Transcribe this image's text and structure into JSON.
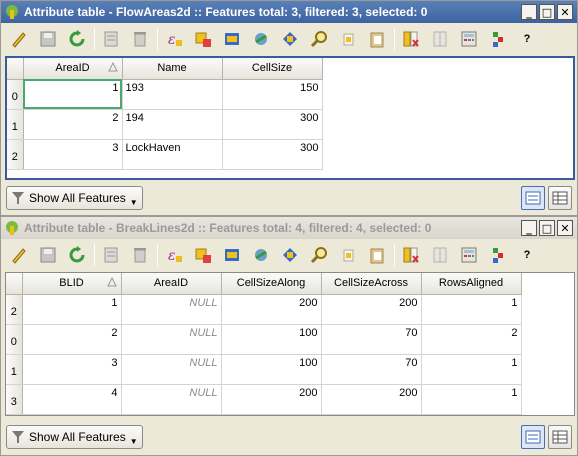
{
  "windows": [
    {
      "title": "Attribute table - FlowAreas2d :: Features total: 3, filtered: 3, selected: 0",
      "active": true,
      "columns": [
        "AreaID",
        "Name",
        "CellSize"
      ],
      "sort_column": "AreaID",
      "rows": [
        {
          "row_header": "0",
          "cells": [
            "1",
            "193",
            "150"
          ]
        },
        {
          "row_header": "1",
          "cells": [
            "2",
            "194",
            "300"
          ]
        },
        {
          "row_header": "2",
          "cells": [
            "3",
            "LockHaven",
            "300"
          ]
        }
      ],
      "show_all_label": "Show All Features"
    },
    {
      "title": "Attribute table - BreakLines2d :: Features total: 4, filtered: 4, selected: 0",
      "active": false,
      "columns": [
        "BLID",
        "AreaID",
        "CellSizeAlong",
        "CellSizeAcross",
        "RowsAligned"
      ],
      "sort_column": "BLID",
      "rows": [
        {
          "row_header": "2",
          "cells": [
            "1",
            "NULL",
            "200",
            "200",
            "1"
          ]
        },
        {
          "row_header": "0",
          "cells": [
            "2",
            "NULL",
            "100",
            "70",
            "2"
          ]
        },
        {
          "row_header": "1",
          "cells": [
            "3",
            "NULL",
            "100",
            "70",
            "1"
          ]
        },
        {
          "row_header": "3",
          "cells": [
            "4",
            "NULL",
            "200",
            "200",
            "1"
          ]
        }
      ],
      "show_all_label": "Show All Features"
    }
  ],
  "window_buttons": {
    "minimize": "_",
    "maximize": "□",
    "close": "✕"
  },
  "toolbar_icons": [
    "toggle-editing-icon",
    "save-edits-icon",
    "reload-icon",
    "add-feature-icon",
    "delete-feature-icon",
    "expression-select-icon",
    "select-all-icon",
    "invert-selection-icon",
    "deselect-icon",
    "move-selection-top-icon",
    "pan-to-selected-icon",
    "zoom-to-selected-icon",
    "copy-icon",
    "paste-icon",
    "delete-column-icon",
    "new-column-icon",
    "field-calculator-icon",
    "conditional-formatting-icon",
    "help-icon"
  ],
  "help_label": "?",
  "colors": {
    "active_title": "#3c63a0",
    "inactive_title": "#d8d5cc",
    "current_cell": "#4aa870"
  }
}
